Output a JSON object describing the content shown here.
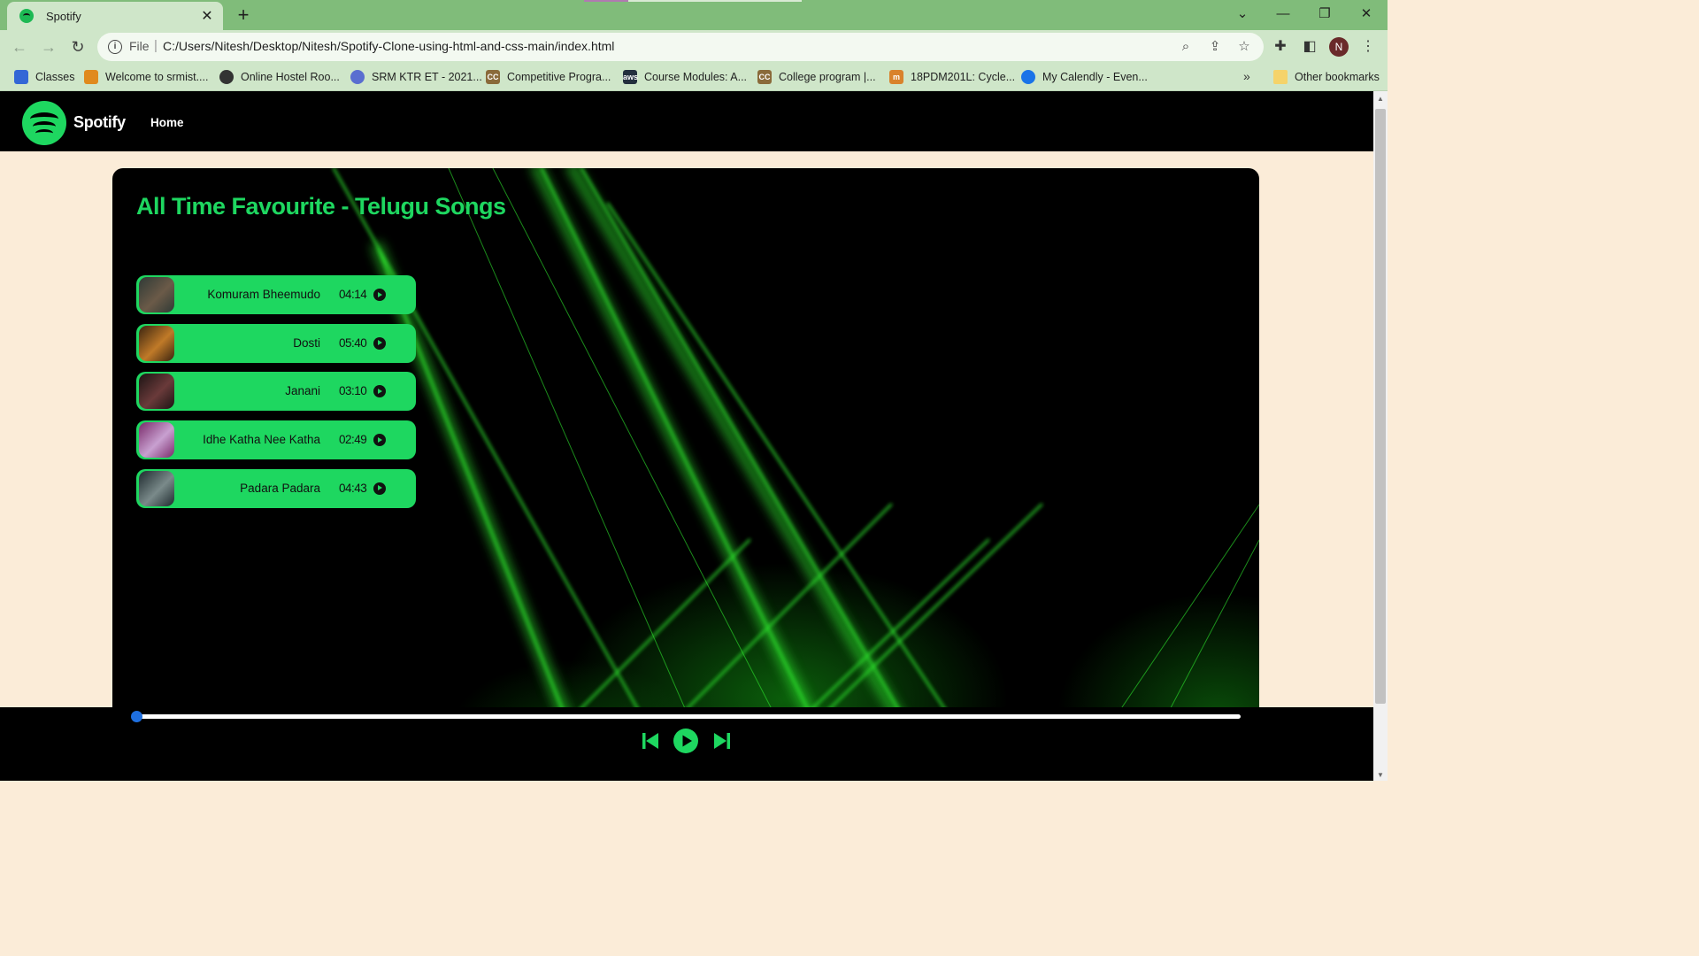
{
  "browser": {
    "tab_title": "Spotify",
    "tab_close": "✕",
    "new_tab": "+",
    "url_scheme": "File",
    "url": "C:/Users/Nitesh/Desktop/Nitesh/Spotify-Clone-using-html-and-css-main/index.html",
    "profile_initial": "N",
    "bookmarks": [
      {
        "label": "Classes",
        "icon": "classroom-icon",
        "color": "#3367d6"
      },
      {
        "label": "Welcome to srmist....",
        "icon": "srm-icon",
        "color": "#e08a1e"
      },
      {
        "label": "Online Hostel Roo...",
        "icon": "globe-icon",
        "color": "#333333"
      },
      {
        "label": "SRM KTR ET - 2021...",
        "icon": "srm-ktr-icon",
        "color": "#5a6ed0"
      },
      {
        "label": "Competitive Progra...",
        "icon": "cc-icon",
        "color": "#8a6a3a"
      },
      {
        "label": "Course Modules: A...",
        "icon": "aws-icon",
        "color": "#232f3e"
      },
      {
        "label": "College program |...",
        "icon": "cc-icon",
        "color": "#8a6a3a"
      },
      {
        "label": "18PDM201L: Cycle...",
        "icon": "m-icon",
        "color": "#d9822b"
      },
      {
        "label": "My Calendly - Even...",
        "icon": "calendly-icon",
        "color": "#1a73e8"
      }
    ],
    "more_bookmarks": "»",
    "other_bookmarks": "Other bookmarks"
  },
  "navbar": {
    "brand": "Spotify",
    "home": "Home"
  },
  "playlist": {
    "title": "All Time Favourite - Telugu Songs",
    "songs": [
      {
        "name": "Komuram Bheemudo",
        "duration": "04:14",
        "cover": [
          "#2f3a36",
          "#6b5a48"
        ]
      },
      {
        "name": "Dosti",
        "duration": "05:40",
        "cover": [
          "#3a2410",
          "#c07a28"
        ]
      },
      {
        "name": "Janani",
        "duration": "03:10",
        "cover": [
          "#1c1414",
          "#6a3a3a"
        ]
      },
      {
        "name": "Idhe Katha Nee Katha",
        "duration": "02:49",
        "cover": [
          "#7a2a6a",
          "#c8a0d0"
        ]
      },
      {
        "name": "Padara Padara",
        "duration": "04:43",
        "cover": [
          "#1e2a2e",
          "#7a8a8a"
        ]
      }
    ]
  },
  "player": {
    "progress": 0.0,
    "accent": "#1ed760",
    "progress_color": "#3b82f6"
  }
}
